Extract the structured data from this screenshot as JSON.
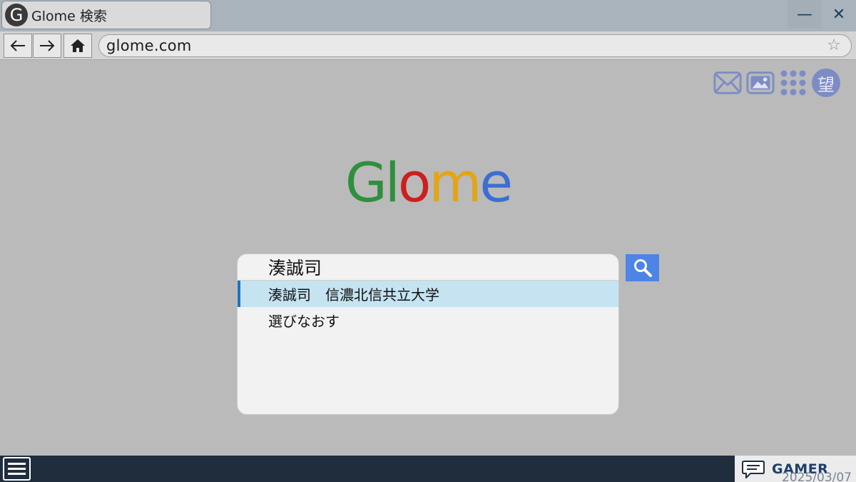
{
  "tab": {
    "logo_letter": "G",
    "title": "Glome 検索"
  },
  "window_controls": {
    "minimize": "—",
    "close": "✕"
  },
  "nav": {
    "back": "←",
    "forward": "→",
    "url": "glome.com",
    "star": "☆"
  },
  "apps": {
    "avatar_char": "望"
  },
  "logo": {
    "letters": [
      {
        "char": "G",
        "color": "#2f8f3e"
      },
      {
        "char": "l",
        "color": "#2f8f3e"
      },
      {
        "char": "o",
        "color": "#cc1f1f"
      },
      {
        "char": "m",
        "color": "#e3a416"
      },
      {
        "char": "e",
        "color": "#3b6fd1"
      }
    ]
  },
  "search": {
    "query": "湊誠司",
    "suggestions": [
      {
        "label": "湊誠司　信濃北信共立大学",
        "active": true
      },
      {
        "label": "選びなおす",
        "active": false
      }
    ]
  },
  "taskbar": {
    "brand": "GAMER",
    "date": "2025/03/07"
  },
  "colors": {
    "accent": "#4d84e6",
    "highlight": "#c5e3f0",
    "taskbar": "#1f2d3d"
  }
}
